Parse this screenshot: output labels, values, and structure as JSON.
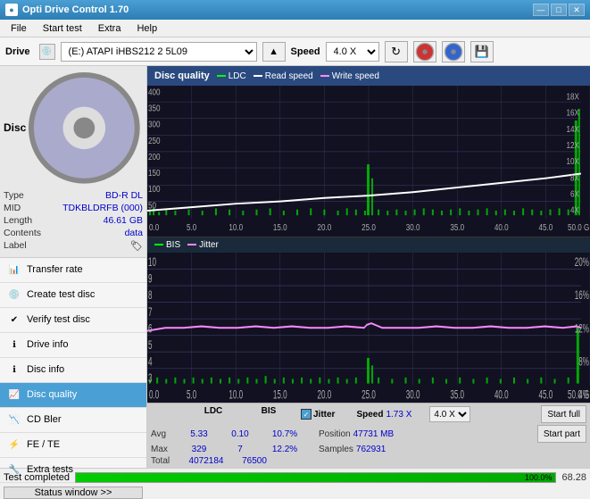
{
  "titlebar": {
    "title": "Opti Drive Control 1.70",
    "min": "—",
    "max": "□",
    "close": "✕"
  },
  "menubar": {
    "items": [
      "File",
      "Start test",
      "Extra",
      "Help"
    ]
  },
  "drivebar": {
    "drive_label": "Drive",
    "drive_value": "(E:) ATAPI iHBS212  2 5L09",
    "speed_label": "Speed",
    "speed_value": "4.0 X"
  },
  "disc": {
    "title": "Disc",
    "type_label": "Type",
    "type_val": "BD-R DL",
    "mid_label": "MID",
    "mid_val": "TDKBLDRFB (000)",
    "length_label": "Length",
    "length_val": "46.61 GB",
    "contents_label": "Contents",
    "contents_val": "data",
    "label_label": "Label"
  },
  "nav": {
    "items": [
      {
        "id": "transfer-rate",
        "label": "Transfer rate",
        "active": false
      },
      {
        "id": "create-test-disc",
        "label": "Create test disc",
        "active": false
      },
      {
        "id": "verify-test-disc",
        "label": "Verify test disc",
        "active": false
      },
      {
        "id": "drive-info",
        "label": "Drive info",
        "active": false
      },
      {
        "id": "disc-info",
        "label": "Disc info",
        "active": false
      },
      {
        "id": "disc-quality",
        "label": "Disc quality",
        "active": true
      },
      {
        "id": "cd-bler",
        "label": "CD Bler",
        "active": false
      },
      {
        "id": "fe-te",
        "label": "FE / TE",
        "active": false
      },
      {
        "id": "extra-tests",
        "label": "Extra tests",
        "active": false
      }
    ]
  },
  "chart": {
    "title": "Disc quality",
    "legend": [
      {
        "label": "LDC",
        "color": "#00ff00"
      },
      {
        "label": "Read speed",
        "color": "#ffffff"
      },
      {
        "label": "Write speed",
        "color": "#ff00ff"
      }
    ],
    "legend2": [
      {
        "label": "BIS",
        "color": "#00ff00"
      },
      {
        "label": "Jitter",
        "color": "#ff88ff"
      }
    ],
    "top_y_max": 400,
    "top_x_max": 50,
    "bottom_y_max": 10,
    "bottom_x_max": 50
  },
  "stats": {
    "ldc_label": "LDC",
    "bis_label": "BIS",
    "jitter_label": "Jitter",
    "jitter_checked": true,
    "speed_label": "Speed",
    "speed_val": "1.73 X",
    "speed_target": "4.0 X",
    "avg_label": "Avg",
    "ldc_avg": "5.33",
    "bis_avg": "0.10",
    "jitter_avg": "10.7%",
    "max_label": "Max",
    "ldc_max": "329",
    "bis_max": "7",
    "jitter_max": "12.2%",
    "total_label": "Total",
    "ldc_total": "4072184",
    "bis_total": "76500",
    "position_label": "Position",
    "position_val": "47731 MB",
    "samples_label": "Samples",
    "samples_val": "762931",
    "start_full": "Start full",
    "start_part": "Start part"
  },
  "statusbar": {
    "status_text": "Test completed",
    "progress": 100,
    "version": "68.28",
    "status_btn": "Status window >>"
  }
}
